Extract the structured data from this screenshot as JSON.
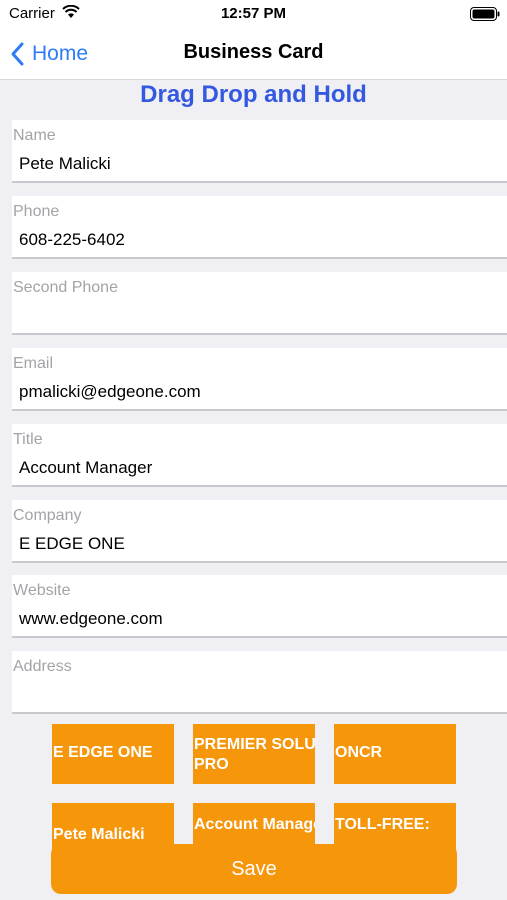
{
  "status_bar": {
    "carrier": "Carrier",
    "time": "12:57 PM"
  },
  "nav": {
    "back_label": "Home",
    "title": "Business Card"
  },
  "heading": "Drag Drop and Hold",
  "fields": [
    {
      "label": "Name",
      "value": "Pete Malicki"
    },
    {
      "label": "Phone",
      "value": "608-225-6402"
    },
    {
      "label": "Second Phone",
      "value": ""
    },
    {
      "label": "Email",
      "value": "pmalicki@edgeone.com"
    },
    {
      "label": "Title",
      "value": "Account Manager"
    },
    {
      "label": "Company",
      "value": "E EDGE ONE"
    },
    {
      "label": "Website",
      "value": "www.edgeone.com"
    },
    {
      "label": "Address",
      "value": ""
    }
  ],
  "chips": [
    "E EDGE ONE",
    "PREMIER SOLUTION PRO",
    "ONCR",
    "Pete Malicki",
    "Account Manager",
    "TOLL-FREE:"
  ],
  "save_label": "Save",
  "colors": {
    "accent": "#f5960b",
    "link": "#2d7cf6",
    "heading": "#3458e0"
  }
}
